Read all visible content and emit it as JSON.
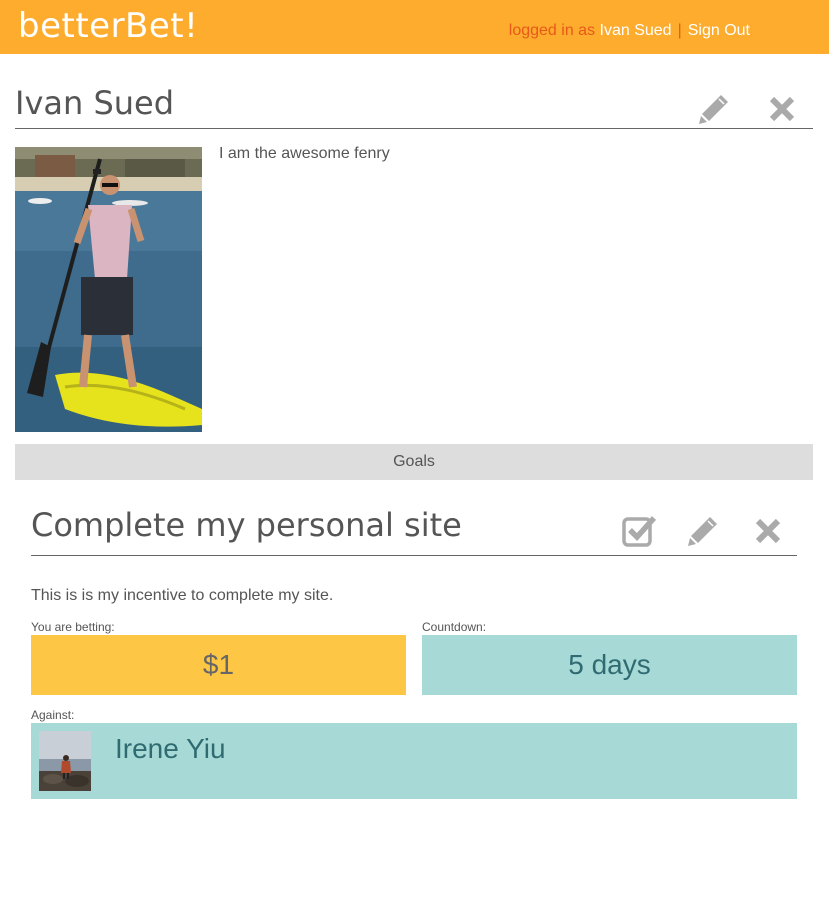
{
  "header": {
    "brand": "betterBet!",
    "logged_in_as": "logged in as",
    "user_name": "Ivan Sued",
    "separator": "|",
    "sign_out": "Sign Out"
  },
  "profile": {
    "name": "Ivan Sued",
    "bio": "I am the awesome fenry",
    "photo": "paddleboarder-photo"
  },
  "goals_section": {
    "label": "Goals"
  },
  "goal": {
    "title": "Complete my personal site",
    "description": "This is is my incentive to complete my site.",
    "betting_label": "You are betting:",
    "bet_amount": "$1",
    "countdown_label": "Countdown:",
    "countdown_value": "5 days",
    "against_label": "Against:",
    "opponent_name": "Irene Yiu",
    "opponent_avatar": "person-on-rocks-avatar"
  },
  "icons": {
    "edit": "pencil-icon",
    "delete": "close-icon",
    "complete": "checkbox-check-icon"
  },
  "colors": {
    "header_bg": "#fdac2d",
    "bet_bg": "#fdc644",
    "countdown_bg": "#a7dad7",
    "section_bar_bg": "#dddddd",
    "icon_gray": "#aaaaaa"
  }
}
